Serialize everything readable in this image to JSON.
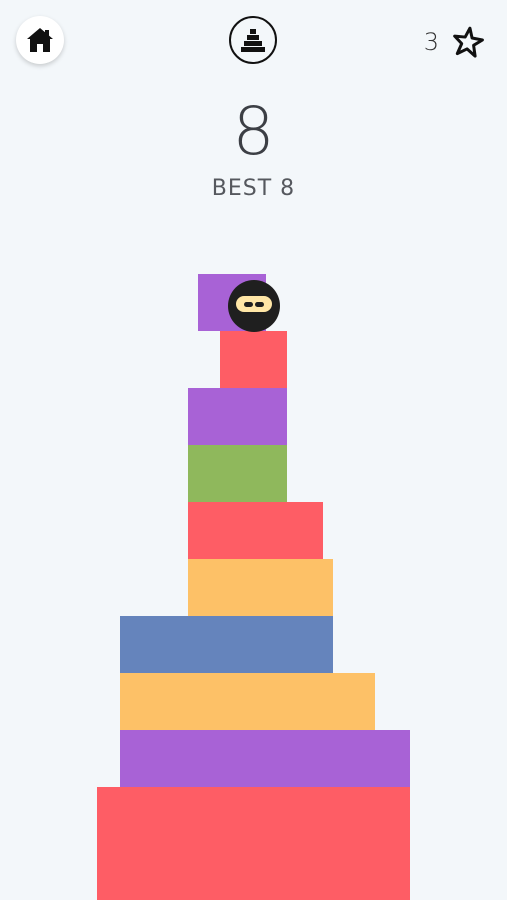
{
  "header": {
    "home_icon": "home-icon",
    "tower_icon": "tower-icon",
    "stars_count": "3",
    "star_icon": "star-icon"
  },
  "score": {
    "current": "8",
    "best_label": "BEST 8"
  },
  "colors": {
    "background": "#f3f7fa",
    "red": "#fe5d65",
    "purple": "#a862d6",
    "green": "#8fb85c",
    "yellow": "#fdc167",
    "blue": "#6584bc"
  },
  "tower": {
    "block_colors": [
      "red",
      "purple",
      "yellow",
      "blue",
      "yellow",
      "red",
      "green",
      "purple",
      "red",
      "purple"
    ],
    "character": "ninja"
  }
}
